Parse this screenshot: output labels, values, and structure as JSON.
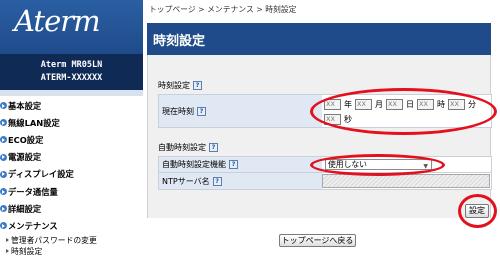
{
  "sidebar": {
    "logo": "Aterm",
    "model_line1": "Aterm  MR05LN",
    "model_line2": "ATERM-XXXXXX",
    "items": [
      {
        "label": "基本設定"
      },
      {
        "label": "無線LAN設定"
      },
      {
        "label": "ECO設定"
      },
      {
        "label": "電源設定"
      },
      {
        "label": "ディスプレイ設定"
      },
      {
        "label": "データ通信量"
      },
      {
        "label": "詳細設定"
      },
      {
        "label": "メンテナンス"
      }
    ],
    "subitems": [
      {
        "label": "管理者パスワードの変更"
      },
      {
        "label": "時刻設定"
      }
    ]
  },
  "main": {
    "breadcrumb": "トップページ > メンテナンス > 時刻設定",
    "title": "時刻設定",
    "section_time": "時刻設定",
    "current_time_label": "現在時刻",
    "fields": {
      "year": "XX",
      "month": "XX",
      "day": "XX",
      "hour": "XX",
      "minute": "XX",
      "second": "XX"
    },
    "units": {
      "year": "年",
      "month": "月",
      "day": "日",
      "hour": "時",
      "minute": "分",
      "second": "秒"
    },
    "section_auto": "自動時刻設定",
    "auto_label": "自動時刻設定機能",
    "auto_value": "使用しない",
    "ntp_label": "NTPサーバ名",
    "help": "?",
    "set_button": "設定",
    "back_button": "トップページへ戻る"
  }
}
